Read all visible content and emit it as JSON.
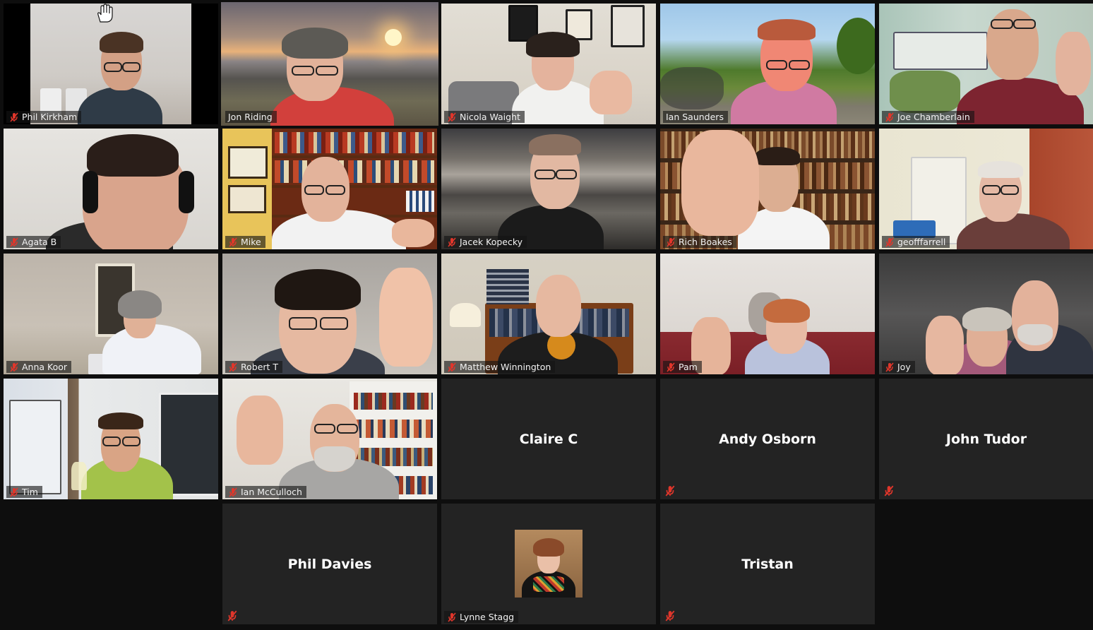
{
  "participants": [
    {
      "name": "Phil Kirkham",
      "video": true,
      "muted": true
    },
    {
      "name": "Jon Riding",
      "video": true,
      "muted": false,
      "active_speaker": true
    },
    {
      "name": "Nicola Waight",
      "video": true,
      "muted": true
    },
    {
      "name": "Ian Saunders",
      "video": true,
      "muted": false
    },
    {
      "name": "Joe Chamberlain",
      "video": true,
      "muted": true
    },
    {
      "name": "Agata B",
      "video": true,
      "muted": true
    },
    {
      "name": "Mike",
      "video": true,
      "muted": true
    },
    {
      "name": "Jacek Kopecky",
      "video": true,
      "muted": true
    },
    {
      "name": "Rich Boakes",
      "video": true,
      "muted": true
    },
    {
      "name": "geofffarrell",
      "video": true,
      "muted": true
    },
    {
      "name": "Anna Koor",
      "video": true,
      "muted": true
    },
    {
      "name": "Robert T",
      "video": true,
      "muted": true
    },
    {
      "name": "Matthew Winnington",
      "video": true,
      "muted": true
    },
    {
      "name": "Pam",
      "video": true,
      "muted": true
    },
    {
      "name": "Joy",
      "video": true,
      "muted": true
    },
    {
      "name": "Tim",
      "video": true,
      "muted": true
    },
    {
      "name": "Ian McCulloch",
      "video": true,
      "muted": true
    },
    {
      "name": "Claire C",
      "video": false,
      "muted": false
    },
    {
      "name": "Andy Osborn",
      "video": false,
      "muted": true
    },
    {
      "name": "John Tudor",
      "video": false,
      "muted": true
    },
    {
      "name": "Phil Davies",
      "video": false,
      "muted": true
    },
    {
      "name": "Lynne Stagg",
      "video": false,
      "muted": true,
      "profile_picture": true
    },
    {
      "name": "Tristan",
      "video": false,
      "muted": true
    }
  ],
  "icons": {
    "muted_mic": "mic-muted-icon",
    "raised_hand": "raised-hand-icon"
  },
  "colors": {
    "active_speaker_border": "#e8ec8c",
    "muted_icon": "#e0362b",
    "tile_background": "#232323",
    "gallery_background": "#0e0e0e"
  }
}
